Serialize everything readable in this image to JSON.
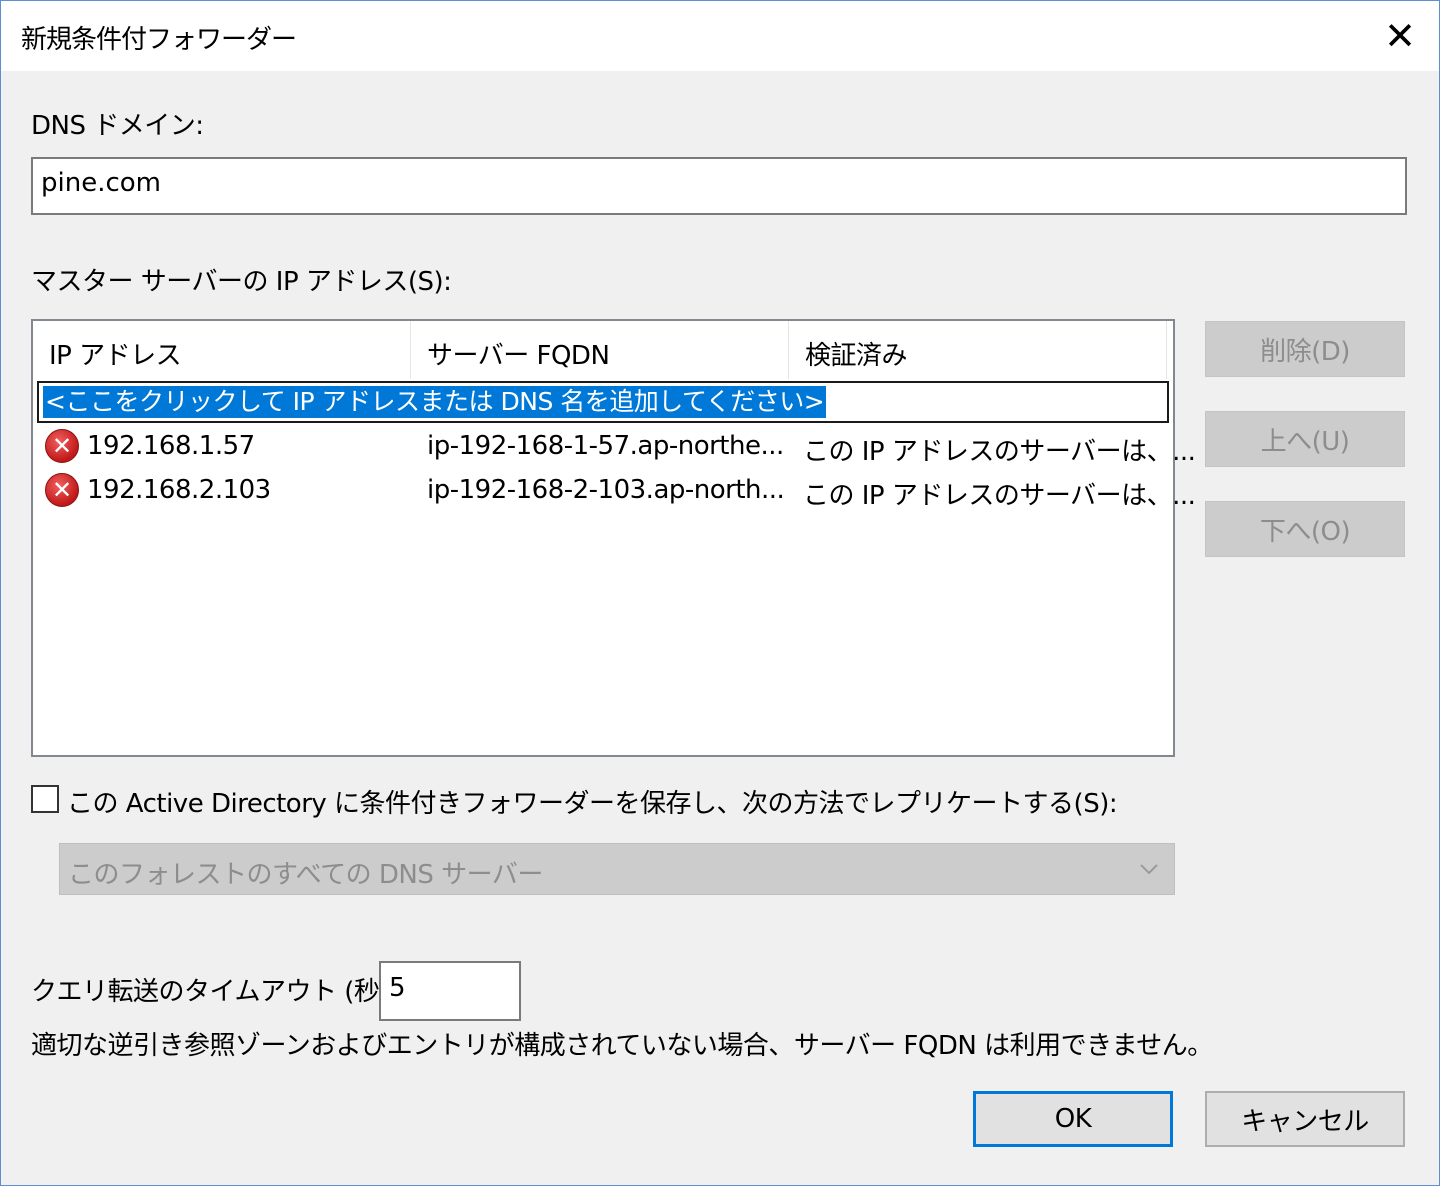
{
  "window": {
    "title": "新規条件付フォワーダー"
  },
  "dns_domain": {
    "label": "DNS ドメイン:",
    "value": "pine.com"
  },
  "master_servers": {
    "label": "マスター サーバーの IP アドレス(S):",
    "columns": [
      "IP アドレス",
      "サーバー FQDN",
      "検証済み"
    ],
    "add_placeholder": "<ここをクリックして IP アドレスまたは DNS 名を追加してください>",
    "rows": [
      {
        "ip": "192.168.1.57",
        "fqdn": "ip-192-168-1-57.ap-northe...",
        "status": "この IP アドレスのサーバーは、...",
        "icon": "error-icon"
      },
      {
        "ip": "192.168.2.103",
        "fqdn": "ip-192-168-2-103.ap-north...",
        "status": "この IP アドレスのサーバーは、...",
        "icon": "error-icon"
      }
    ]
  },
  "side_buttons": {
    "delete": "削除(D)",
    "up": "上へ(U)",
    "down": "下へ(O)"
  },
  "replicate": {
    "checkbox_label": "この Active Directory に条件付きフォワーダーを保存し、次の方法でレプリケートする(S):",
    "checked": false,
    "selected": "このフォレストのすべての DNS サーバー"
  },
  "timeout": {
    "label": "クエリ転送のタイムアウト (秒):",
    "value": "5"
  },
  "note": "適切な逆引き参照ゾーンおよびエントリが構成されていない場合、サーバー FQDN は利用できません。",
  "footer": {
    "ok": "OK",
    "cancel": "キャンセル"
  },
  "colors": {
    "selection": "#0078d7",
    "error": "#c01818"
  }
}
